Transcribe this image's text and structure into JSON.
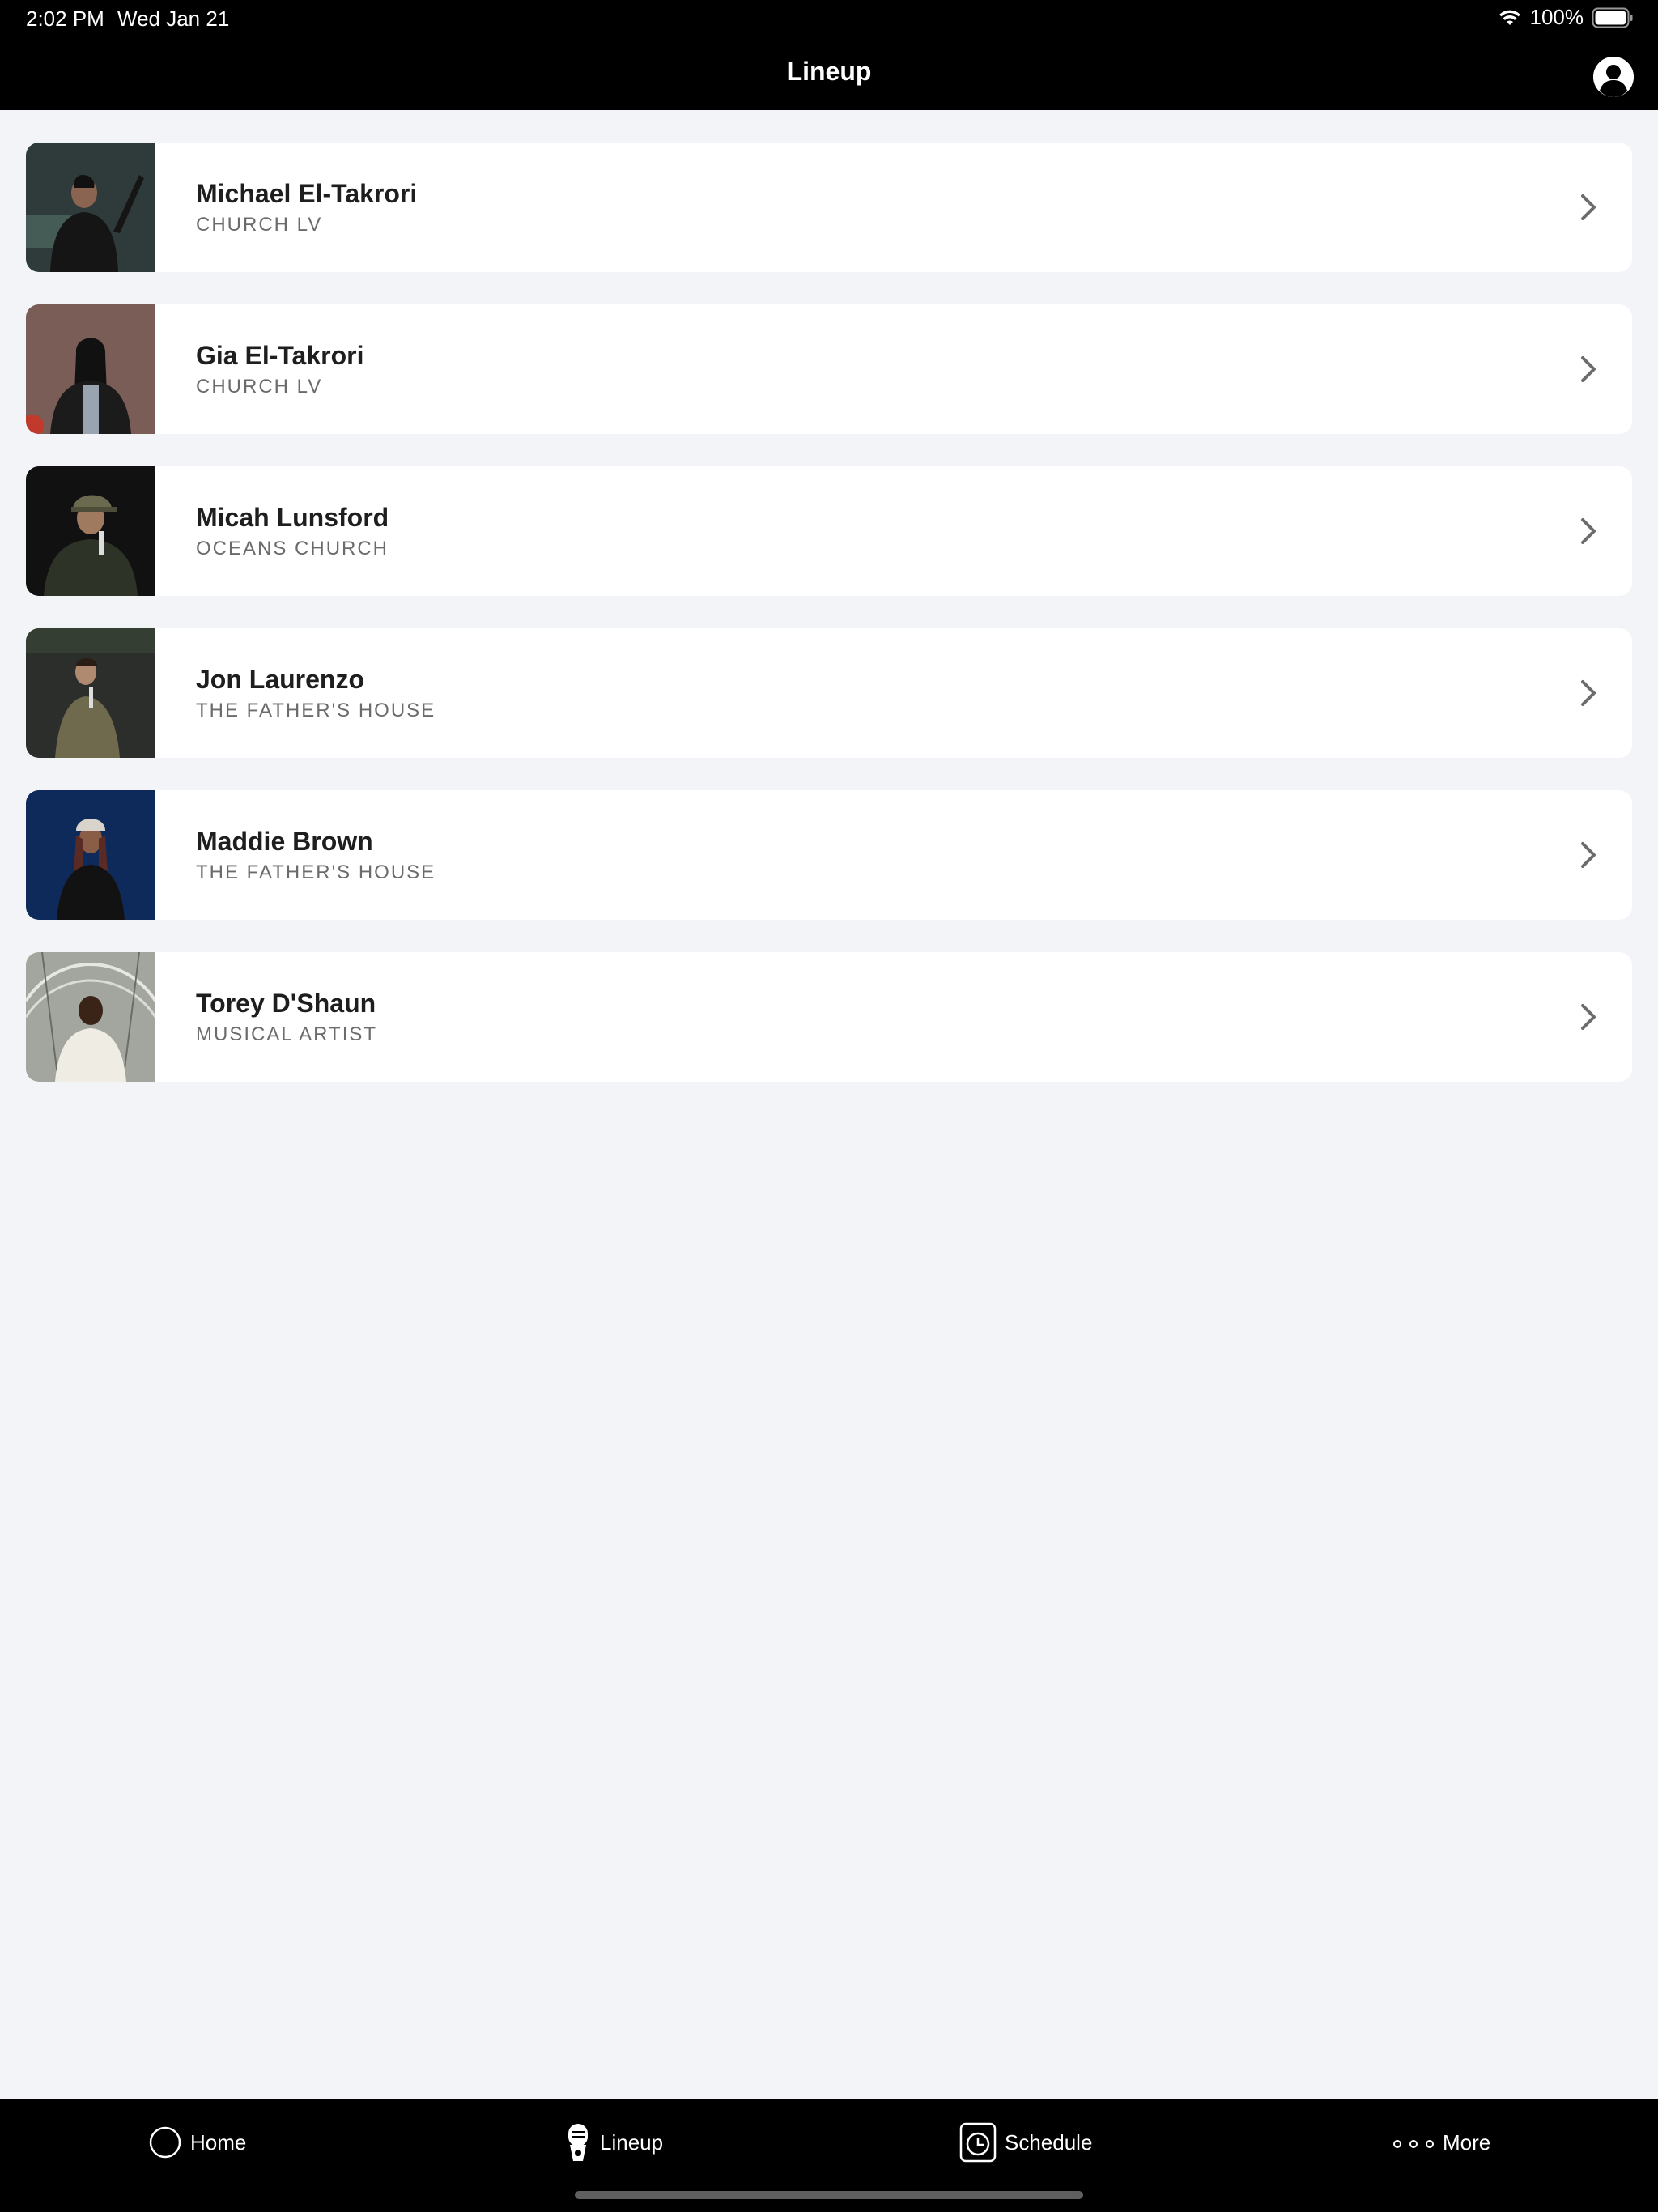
{
  "status_bar": {
    "time": "2:02 PM",
    "date": "Wed Jan 21",
    "battery": "100%"
  },
  "header": {
    "title": "Lineup",
    "profile_icon": "person-circle-icon"
  },
  "speakers": [
    {
      "name": "Michael El-Takrori",
      "org": "CHURCH LV",
      "photo_bg": "#2f3a3a"
    },
    {
      "name": "Gia El-Takrori",
      "org": "CHURCH LV",
      "photo_bg": "#7a5d56"
    },
    {
      "name": "Micah Lunsford",
      "org": "OCEANS CHURCH",
      "photo_bg": "#111111"
    },
    {
      "name": "Jon Laurenzo",
      "org": "THE FATHER'S HOUSE",
      "photo_bg": "#2b2e2a"
    },
    {
      "name": "Maddie Brown",
      "org": "THE FATHER'S HOUSE",
      "photo_bg": "#0e2a5a"
    },
    {
      "name": "Torey D'Shaun",
      "org": "MUSICAL ARTIST",
      "photo_bg": "#8d8f8a"
    }
  ],
  "tab_bar": {
    "tabs": [
      {
        "label": "Home",
        "icon": "circle-icon"
      },
      {
        "label": "Lineup",
        "icon": "microphone-icon"
      },
      {
        "label": "Schedule",
        "icon": "clock-icon"
      },
      {
        "label": "More",
        "icon": "more-dots-icon"
      }
    ]
  }
}
